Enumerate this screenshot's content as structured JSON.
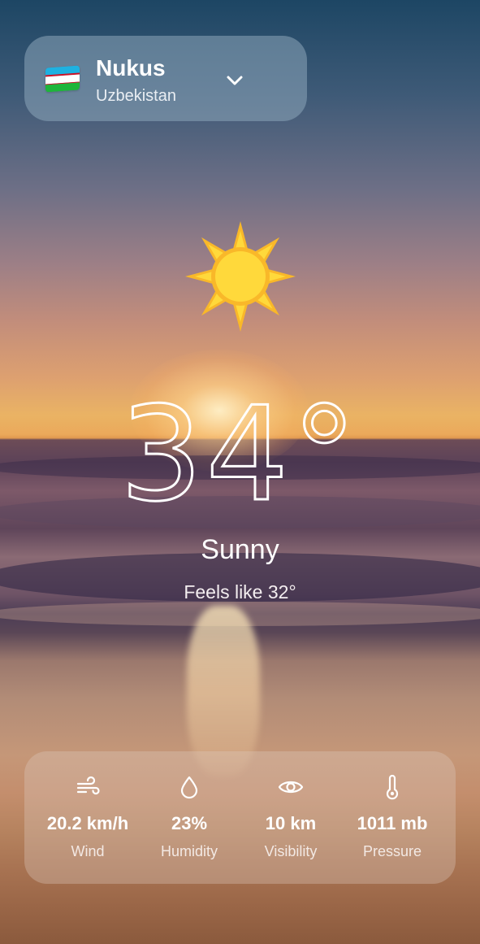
{
  "location": {
    "city": "Nukus",
    "country": "Uzbekistan",
    "flag_icon": "uzbekistan-flag-icon"
  },
  "weather": {
    "temperature": "34",
    "degree_symbol": "°",
    "condition": "Sunny",
    "feels_like": "Feels like 32°",
    "condition_icon": "sun-icon"
  },
  "stats": [
    {
      "icon": "wind-icon",
      "value": "20.2 km/h",
      "label": "Wind"
    },
    {
      "icon": "water-drop-icon",
      "value": "23%",
      "label": "Humidity"
    },
    {
      "icon": "eye-icon",
      "value": "10 km",
      "label": "Visibility"
    },
    {
      "icon": "thermometer-icon",
      "value": "1011 mb",
      "label": "Pressure"
    }
  ],
  "colors": {
    "text": "#ffffff",
    "sun_outer": "#f9b829",
    "sun_inner": "#ffd93b"
  }
}
